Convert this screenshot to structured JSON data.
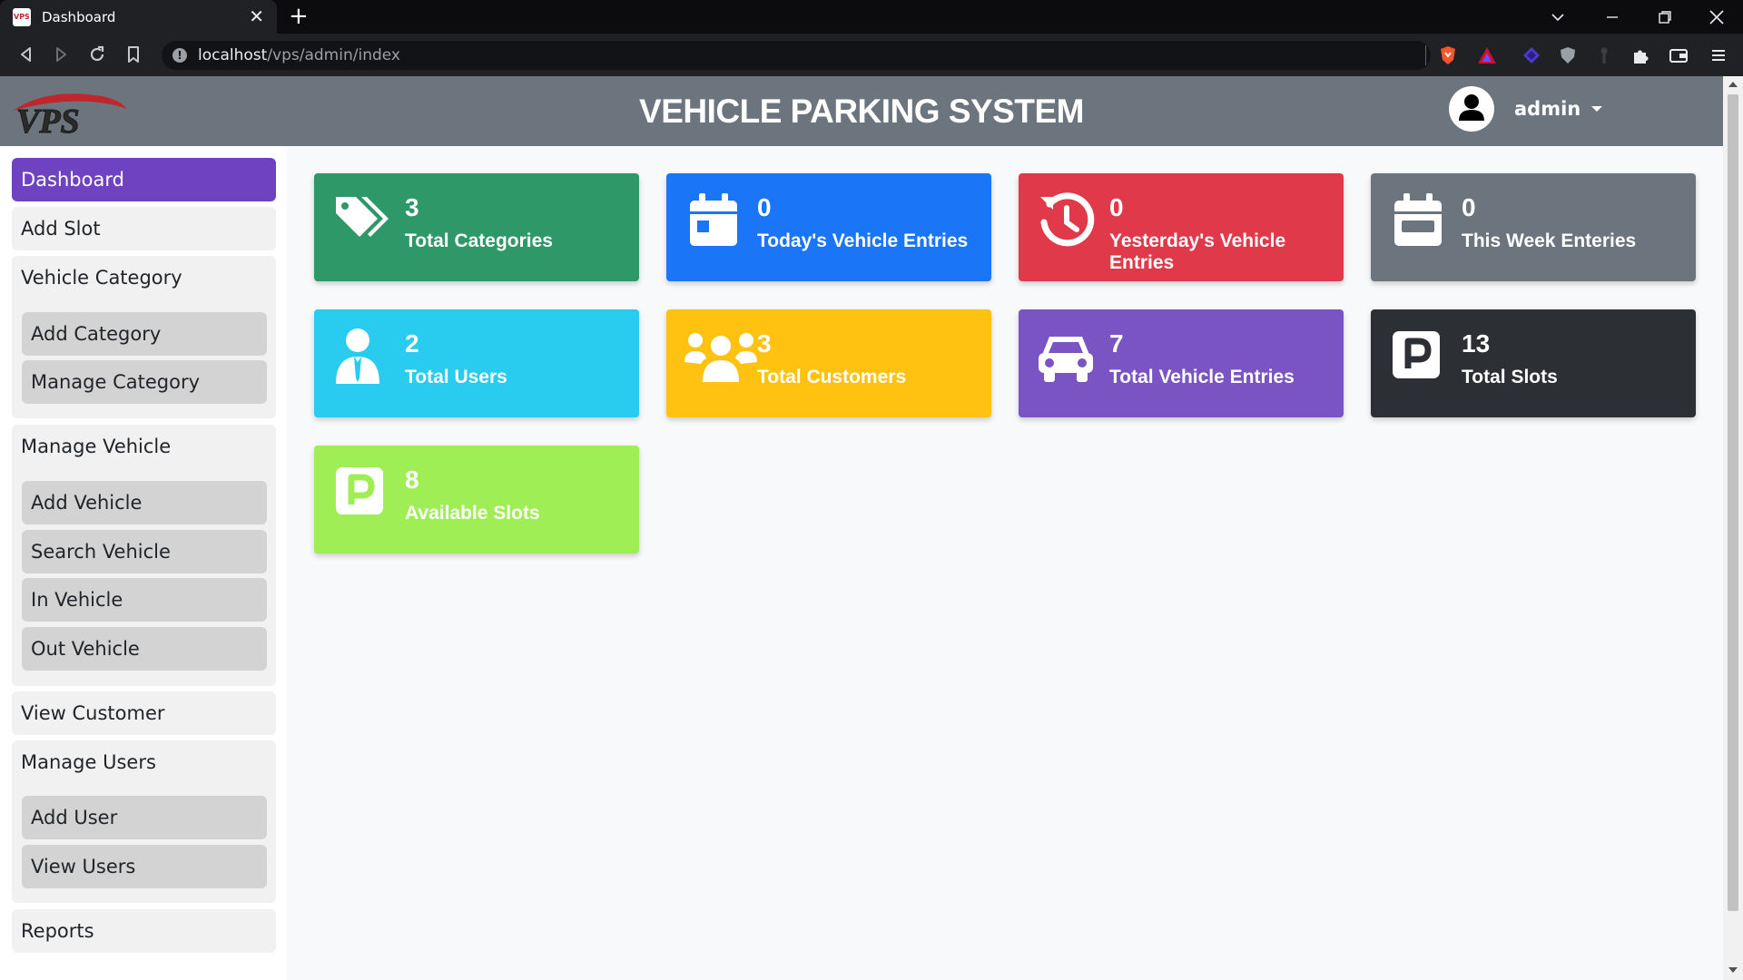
{
  "browser": {
    "tab_title": "Dashboard",
    "url_host": "localhost",
    "url_path": "/vps/admin/index"
  },
  "header": {
    "logo_text": "VPS",
    "title": "VEHICLE PARKING SYSTEM",
    "user_name": "admin"
  },
  "sidebar": {
    "items": [
      {
        "label": "Dashboard",
        "active": true
      },
      {
        "label": "Add Slot"
      },
      {
        "label": "Vehicle Category",
        "children": [
          "Add Category",
          "Manage Category"
        ]
      },
      {
        "label": "Manage Vehicle",
        "children": [
          "Add Vehicle",
          "Search Vehicle",
          "In Vehicle",
          "Out Vehicle"
        ]
      },
      {
        "label": "View Customer"
      },
      {
        "label": "Manage Users",
        "children": [
          "Add User",
          "View Users"
        ]
      },
      {
        "label": "Reports"
      }
    ]
  },
  "cards": [
    {
      "value": "3",
      "label": "Total Categories",
      "icon": "tags-icon",
      "color": "#2e9868"
    },
    {
      "value": "0",
      "label": "Today's Vehicle Entries",
      "icon": "calendar-day-icon",
      "color": "#1a76f7"
    },
    {
      "value": "0",
      "label": "Yesterday's Vehicle Entries",
      "icon": "history-icon",
      "color": "#e03a4a"
    },
    {
      "value": "0",
      "label": "This Week Enteries",
      "icon": "calendar-week-icon",
      "color": "#6c757d"
    },
    {
      "value": "2",
      "label": "Total Users",
      "icon": "user-tie-icon",
      "color": "#29cbef"
    },
    {
      "value": "3",
      "label": "Total Customers",
      "icon": "users-icon",
      "color": "#ffc210"
    },
    {
      "value": "7",
      "label": "Total Vehicle Entries",
      "icon": "car-icon",
      "color": "#7954c2"
    },
    {
      "value": "13",
      "label": "Total Slots",
      "icon": "parking-icon",
      "color": "#2c3034"
    },
    {
      "value": "8",
      "label": "Available Slots",
      "icon": "parking-icon",
      "color": "#a0ee56"
    }
  ]
}
